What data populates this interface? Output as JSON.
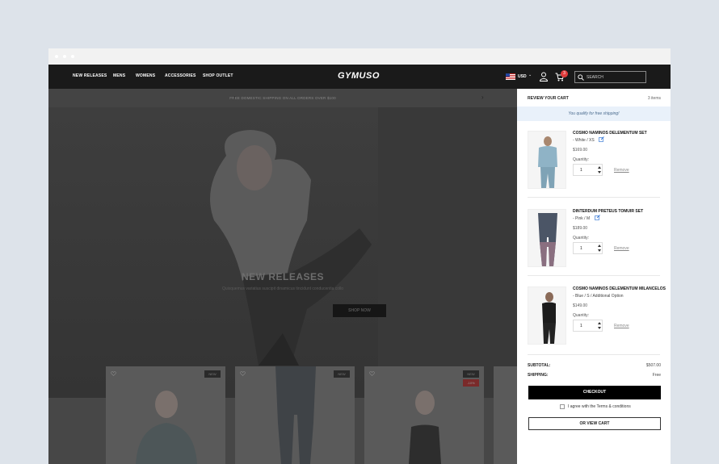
{
  "nav": {
    "links": [
      "NEW RELEASES",
      "MENS",
      "WOMENS",
      "ACCESSORIES",
      "SHOP OUTLET"
    ],
    "logo": "GYMUSO",
    "currency": "USD",
    "cart_count": "3",
    "search_placeholder": "SEARCH"
  },
  "promo": {
    "text": "FREE DOMESTIC SHIPPING ON ALL ORDERS OVER $100"
  },
  "hero": {
    "title": "NEW RELEASES",
    "subtitle": "Quisquemus variatius suscipit dinamicus tincidunt conducentia collo",
    "button": "SHOP NOW"
  },
  "products": {
    "badges": [
      {
        "new": "NEW"
      },
      {
        "new": "NEW"
      },
      {
        "new": "NEW",
        "sale": "-10%"
      }
    ]
  },
  "cart": {
    "title": "REVIEW YOUR CART",
    "count": "3 items",
    "free_shipping": "You qualify for free shipping!",
    "qty_label": "Quantity:",
    "remove_label": "Remove",
    "items": [
      {
        "name": "COSMO NAMINOS DELEMENTUM SET",
        "variant": "- White / XS",
        "price": "$169.00",
        "qty": "1"
      },
      {
        "name": "DINTERDUM PRETEUS TOMUIR SET",
        "variant": "- Pink / M",
        "price": "$189.00",
        "qty": "1"
      },
      {
        "name": "COSMO NAMINOS DELEMENTUM MILANCELOS",
        "variant": "- Blue / S / Additional Option",
        "price": "$149.00",
        "qty": "1"
      }
    ],
    "subtotal_label": "SUBTOTAL:",
    "subtotal_value": "$507.00",
    "shipping_label": "SHIPPING:",
    "shipping_value": "Free",
    "checkout": "CHECKOUT",
    "terms": "I agree with the Terms & conditions",
    "view_cart": "OR VIEW CART"
  },
  "colors": {
    "accent": "#e03b3b",
    "nav_bg": "#1a1a1a",
    "freeship_bg": "#e9f1fa"
  },
  "icons": [
    "user-icon",
    "cart-icon",
    "search-icon",
    "flag-icon",
    "heart-icon",
    "edit-icon",
    "chevron-left-icon",
    "chevron-right-icon"
  ]
}
